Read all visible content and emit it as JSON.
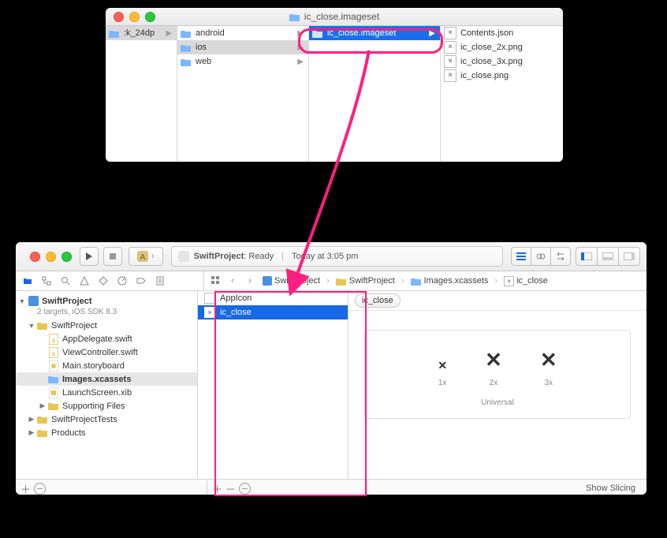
{
  "finder": {
    "title": "ic_close.imageset",
    "col0_item": ":k_24dp",
    "col1": [
      {
        "name": "android",
        "type": "folder",
        "arrow": true,
        "selected": false
      },
      {
        "name": "ios",
        "type": "folder",
        "arrow": true,
        "selected": "gray"
      },
      {
        "name": "web",
        "type": "folder",
        "arrow": true,
        "selected": false
      }
    ],
    "col2": [
      {
        "name": "ic_close.imageset",
        "type": "folder",
        "arrow": true,
        "selected": "blue"
      }
    ],
    "col3": [
      {
        "name": "Contents.json",
        "type": "file"
      },
      {
        "name": "ic_close_2x.png",
        "type": "file"
      },
      {
        "name": "ic_close_3x.png",
        "type": "file"
      },
      {
        "name": "ic_close.png",
        "type": "file"
      }
    ]
  },
  "xcode": {
    "status": {
      "project": "SwiftProject",
      "state": "Ready",
      "time": "Today at 3:05 pm"
    },
    "crumbs": [
      "SwiftProject",
      "SwiftProject",
      "Images.xcassets",
      "ic_close"
    ],
    "tree": {
      "project": "SwiftProject",
      "subtitle": "2 targets, iOS SDK 8.3",
      "groups": [
        {
          "name": "SwiftProject",
          "open": true,
          "children": [
            {
              "name": "AppDelegate.swift",
              "icon": "swift"
            },
            {
              "name": "ViewController.swift",
              "icon": "swift"
            },
            {
              "name": "Main.storyboard",
              "icon": "sb"
            },
            {
              "name": "Images.xcassets",
              "icon": "assets",
              "selected": true
            },
            {
              "name": "LaunchScreen.xib",
              "icon": "xib"
            },
            {
              "name": "Supporting Files",
              "icon": "folder",
              "arrow": true
            }
          ]
        },
        {
          "name": "SwiftProjectTests",
          "open": false
        },
        {
          "name": "Products",
          "open": false
        }
      ]
    },
    "assets": {
      "items": [
        {
          "name": "AppIcon",
          "selected": false
        },
        {
          "name": "ic_close",
          "selected": true
        }
      ]
    },
    "canvas": {
      "title": "ic_close",
      "slots": [
        {
          "label": "1x",
          "size": 12
        },
        {
          "label": "2x",
          "size": 22
        },
        {
          "label": "3x",
          "size": 22
        }
      ],
      "universal": "Universal",
      "show_slicing": "Show Slicing"
    },
    "footer": {
      "plus": "+",
      "minus": "—"
    }
  }
}
